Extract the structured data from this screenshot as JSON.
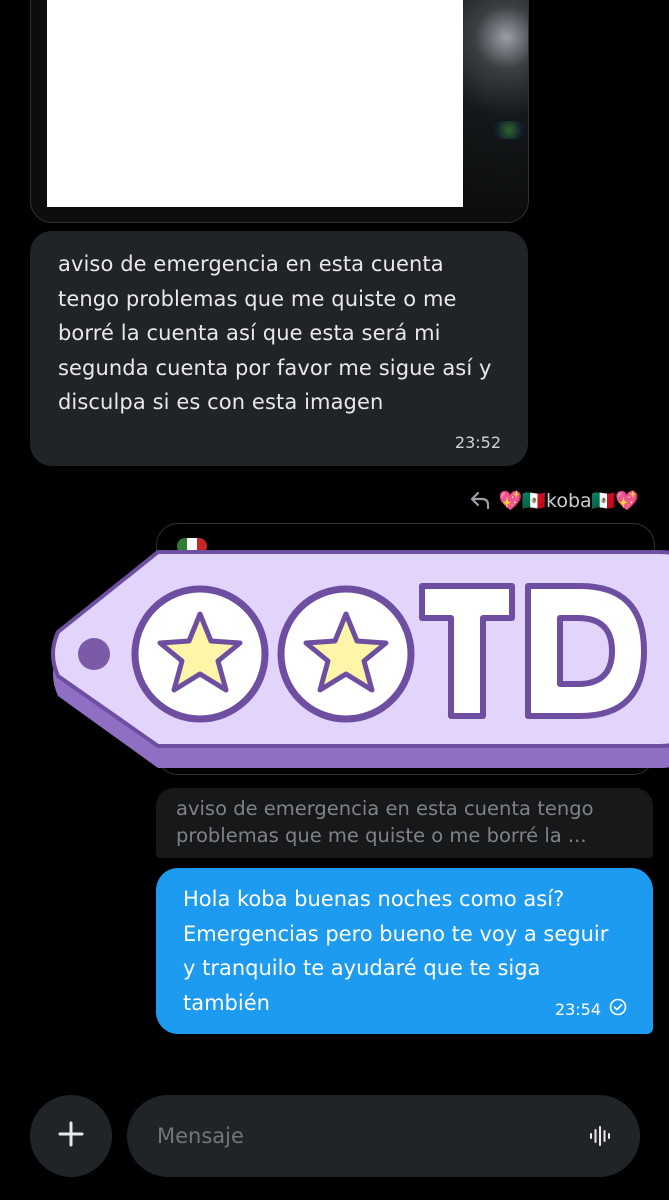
{
  "incoming": {
    "text": "aviso de emergencia en esta cuenta tengo problemas que me quiste o me borré la cuenta así que esta será mi segunda cuenta por favor me sigue así y disculpa si es con esta imagen",
    "time": "23:52"
  },
  "reply": {
    "icon": "reply-arrow-icon",
    "to_name": "💖🇲🇽koba🇲🇽💖"
  },
  "sticker": {
    "text": "TD",
    "icons": [
      "star-icon",
      "star-icon"
    ],
    "colors": {
      "fill": "#d9c9f7",
      "outline": "#7a5fa8",
      "star": "#fdf5a8"
    }
  },
  "quote": {
    "text": "aviso de emergencia en esta cuenta tengo problemas que me quiste o me borré la ..."
  },
  "outgoing": {
    "text": "Hola koba buenas noches como así? Emergencias pero bueno te voy a seguir y tranquilo te ayudaré que te siga también",
    "time": "23:54",
    "status_icon": "read-check-icon"
  },
  "composer": {
    "placeholder": "Mensaje",
    "add_icon": "plus-icon",
    "voice_icon": "voice-waveform-icon"
  },
  "colors": {
    "background": "#000000",
    "incoming_bubble": "#202327",
    "outgoing_bubble": "#1d9bf0"
  }
}
